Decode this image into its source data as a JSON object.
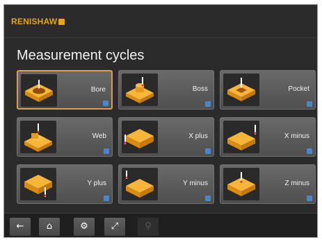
{
  "brand": {
    "logo_text": "RENISHAW",
    "color": "#e8a316"
  },
  "page": {
    "title": "Measurement cycles"
  },
  "cycles": [
    {
      "label": "Bore",
      "icon": "bore-icon"
    },
    {
      "label": "Boss",
      "icon": "boss-icon"
    },
    {
      "label": "Pocket",
      "icon": "pocket-icon"
    },
    {
      "label": "Web",
      "icon": "web-icon"
    },
    {
      "label": "X plus",
      "icon": "x-plus-icon"
    },
    {
      "label": "X minus",
      "icon": "x-minus-icon"
    },
    {
      "label": "Y plus",
      "icon": "y-plus-icon"
    },
    {
      "label": "Y minus",
      "icon": "y-minus-icon"
    },
    {
      "label": "Z minus",
      "icon": "z-minus-icon"
    }
  ],
  "selected_cycle": "Bore",
  "toolbar": [
    {
      "icon": "back-arrow-icon",
      "glyph": "←"
    },
    {
      "icon": "home-icon",
      "glyph": "⌂"
    },
    {
      "icon": "gear-icon",
      "glyph": "⚙"
    },
    {
      "icon": "resize-icon",
      "glyph": "⤢"
    },
    {
      "icon": "disabled-icon",
      "glyph": "⚲"
    }
  ],
  "colors": {
    "accent": "#d8a050",
    "badge": "#4a86c8",
    "part": "#f0a020"
  }
}
